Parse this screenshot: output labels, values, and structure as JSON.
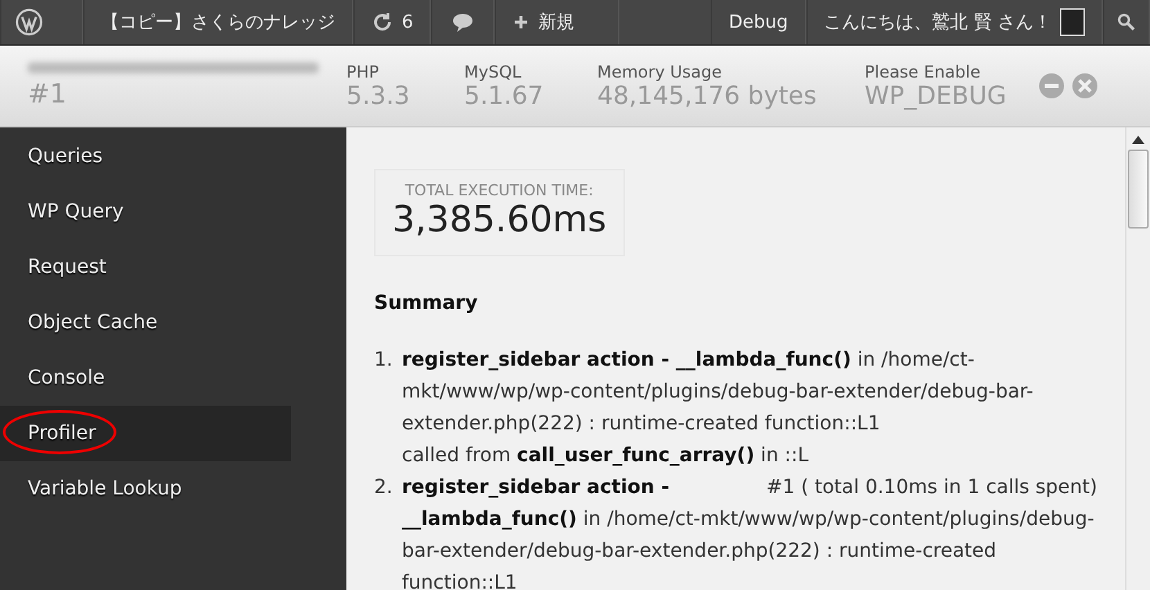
{
  "admin_bar": {
    "left": [
      {
        "kind": "logo"
      },
      {
        "kind": "text",
        "label": "【コピー】さくらのナレッジ"
      },
      {
        "kind": "updates",
        "label": "6"
      },
      {
        "kind": "comments"
      },
      {
        "kind": "new",
        "label": "新規"
      }
    ],
    "right": [
      {
        "kind": "text",
        "label": "Debug"
      },
      {
        "kind": "account",
        "label": "こんにちは、鷲北 賢 さん！"
      },
      {
        "kind": "search"
      }
    ]
  },
  "header": {
    "site_id": "#1",
    "stats": [
      {
        "label": "PHP",
        "value": "5.3.3"
      },
      {
        "label": "MySQL",
        "value": "5.1.67"
      },
      {
        "label": "Memory Usage",
        "value": "48,145,176 bytes"
      },
      {
        "label": "Please Enable",
        "value": "WP_DEBUG"
      }
    ]
  },
  "sidebar": {
    "items": [
      {
        "label": "Queries",
        "selected": false,
        "circled": false
      },
      {
        "label": "WP Query",
        "selected": false,
        "circled": false
      },
      {
        "label": "Request",
        "selected": false,
        "circled": false
      },
      {
        "label": "Object Cache",
        "selected": false,
        "circled": false
      },
      {
        "label": "Console",
        "selected": false,
        "circled": false
      },
      {
        "label": "Profiler",
        "selected": true,
        "circled": true
      },
      {
        "label": "Variable Lookup",
        "selected": false,
        "circled": false
      }
    ]
  },
  "panel": {
    "timer": {
      "label": "TOTAL EXECUTION TIME:",
      "value": "3,385.60ms"
    },
    "summary_title": "Summary",
    "entries": [
      {
        "number": "1.",
        "heading": "**register_sidebar action - __lambda_func()** in /home/ct-mkt/www/wp/wp-content/plugins/debug-bar-extender/debug-bar-extender.php(222) : runtime-created function::L1",
        "lines": [
          "called from **call_user_func_array()** in ::L"
        ]
      },
      {
        "number": "2.",
        "heading": "**register_sidebar action -**",
        "total": "#1 ( total 0.10ms in 1 calls spent)",
        "lines": [
          "**__lambda_func()** in /home/ct-mkt/www/wp/wp-content/plugins/debug-bar-extender/debug-bar-extender.php(222) : runtime-created function::L1"
        ]
      }
    ]
  }
}
